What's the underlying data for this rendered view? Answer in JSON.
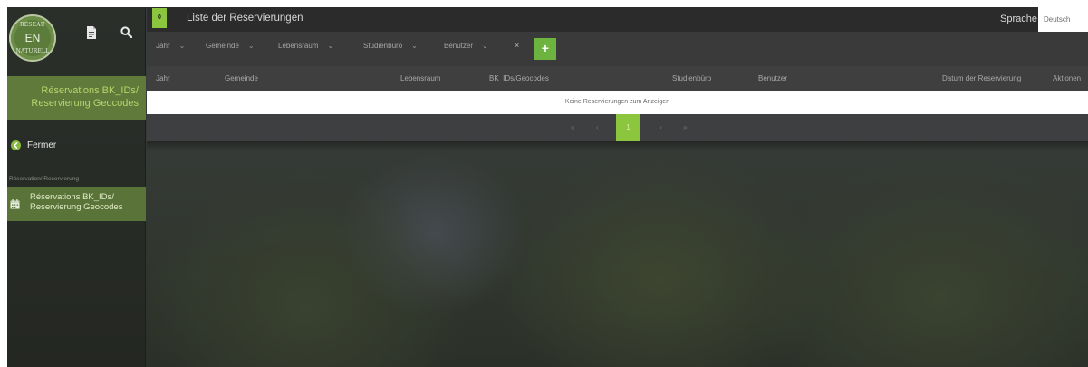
{
  "sidebar": {
    "logo": {
      "top_text": "RÉSEAU",
      "center_text": "EN",
      "bottom_text": "NATURELL"
    },
    "icons": [
      "document-icon",
      "search-icon"
    ],
    "section_title": "Réservations BK_IDs/ Reservierung Geocodes",
    "close_label": "Fermer",
    "group_label": "Réservation/ Reservierung",
    "nav_item_label": "Réservations BK_IDs/ Reservierung Geocodes"
  },
  "topbar": {
    "count": "0",
    "title": "Liste der Reservierungen",
    "language_label": "Sprache",
    "language_value": "Deutsch"
  },
  "filters": {
    "items": [
      "Jahr",
      "Gemeinde",
      "Lebensraum",
      "Studienbüro",
      "Benutzer"
    ],
    "clear_symbol": "×",
    "add_symbol": "+"
  },
  "table": {
    "columns": [
      "Jahr",
      "Gemeinde",
      "Lebensraum",
      "BK_IDs/Geocodes",
      "Studienbüro",
      "Benutzer",
      "Datum der Reservierung",
      "Aktionen"
    ],
    "empty_message": "Keine Reservierungen zum Anzeigen"
  },
  "pagination": {
    "first": "«",
    "prev": "‹",
    "current": "1",
    "next": "›",
    "last": "»"
  },
  "colors": {
    "accent_green": "#8cc63f",
    "sidebar_active": "#5a7339",
    "topbar": "#2a2b2a"
  }
}
